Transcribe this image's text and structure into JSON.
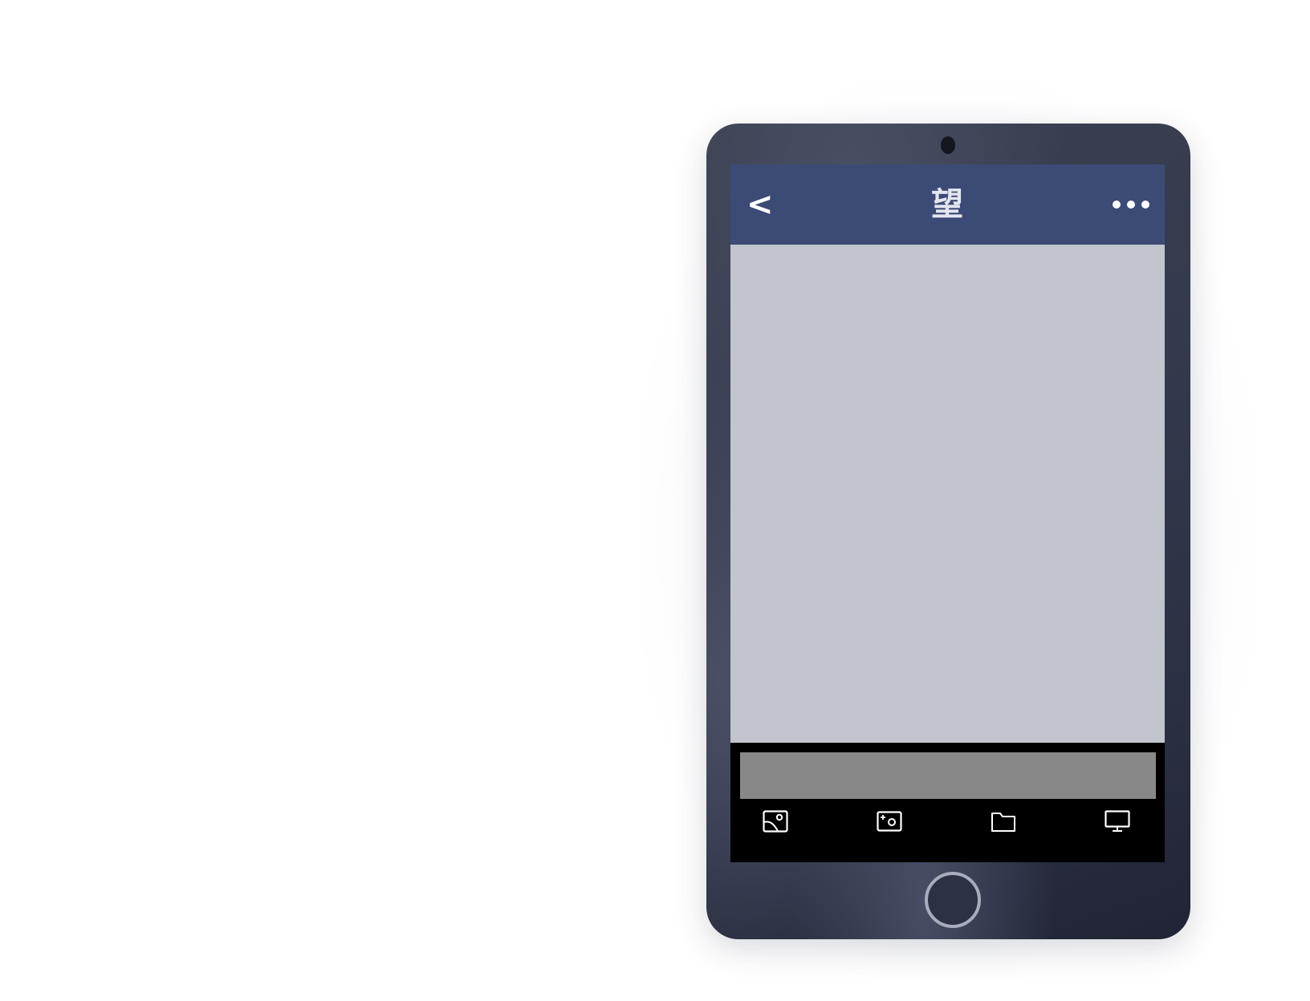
{
  "app": {
    "title": "望"
  },
  "navbar": {
    "back_label": "<",
    "title": "望",
    "more_icon": "more-dots-icon"
  },
  "toolbar": {
    "input_value": "",
    "buttons": [
      {
        "icon": "image-icon"
      },
      {
        "icon": "camera-icon"
      },
      {
        "icon": "folder-icon"
      },
      {
        "icon": "monitor-icon"
      }
    ]
  },
  "colors": {
    "navbar": "#3c4a76",
    "content": "#c2c5ce",
    "toolbar": "#000000",
    "input": "#888888",
    "device": "#343a4d"
  }
}
